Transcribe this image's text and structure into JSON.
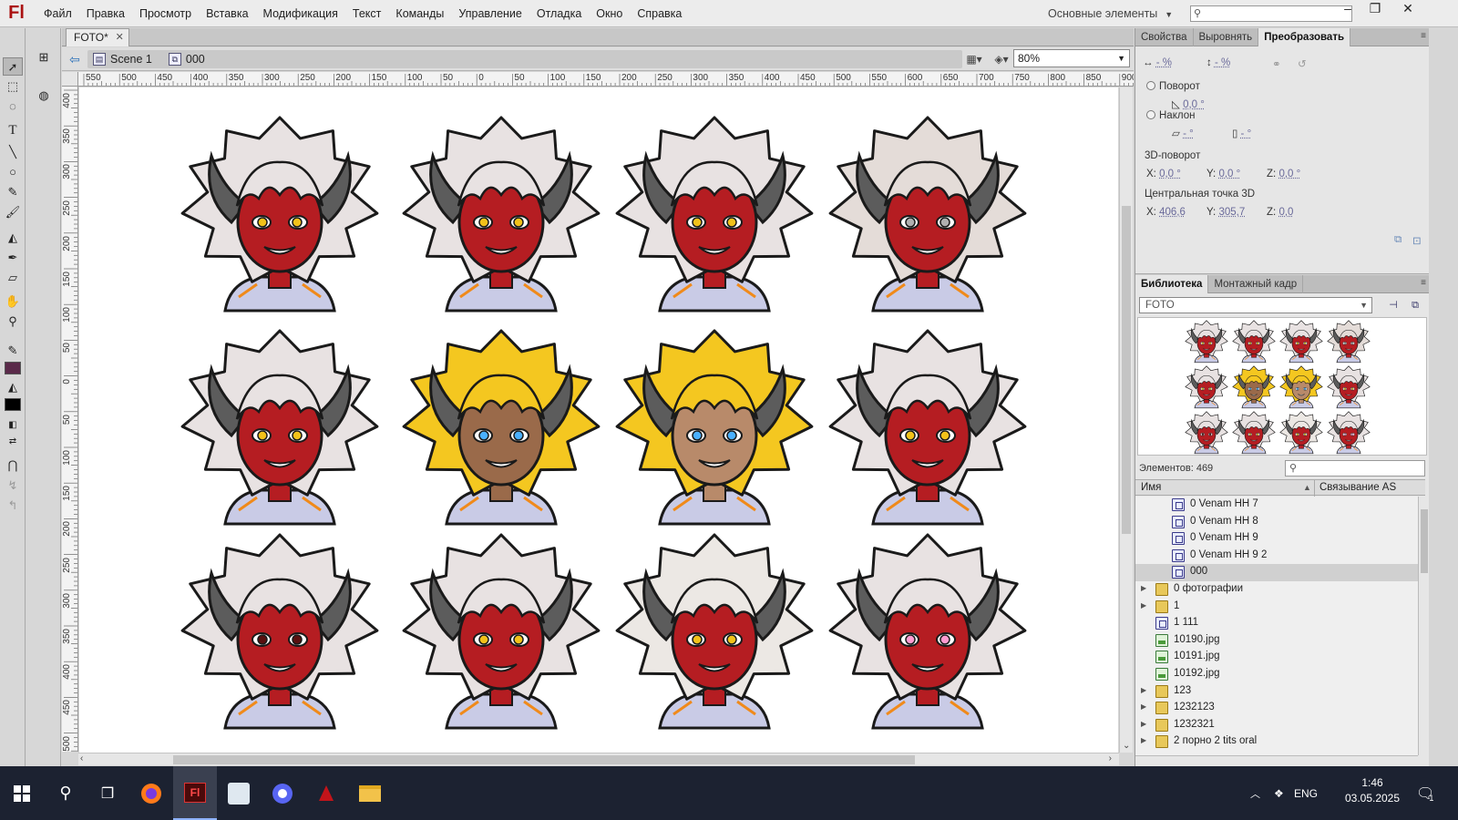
{
  "app": {
    "logo": "Fl",
    "menu": [
      "Файл",
      "Правка",
      "Просмотр",
      "Вставка",
      "Модификация",
      "Текст",
      "Команды",
      "Управление",
      "Отладка",
      "Окно",
      "Справка"
    ],
    "workspace": "Основные элементы",
    "window_controls": [
      "–",
      "❐",
      "✕"
    ]
  },
  "document": {
    "tab_title": "FOTO*",
    "breadcrumb": [
      {
        "label": "Scene 1",
        "icon": "scene-icon"
      },
      {
        "label": "000",
        "icon": "symbol-icon"
      }
    ],
    "zoom": "80%"
  },
  "rulers": {
    "top_labels": [
      "550",
      "500",
      "450",
      "400",
      "350",
      "300",
      "250",
      "200",
      "150",
      "100",
      "50",
      "0",
      "50",
      "100",
      "150",
      "200",
      "250",
      "300",
      "350",
      "400",
      "450",
      "500",
      "550",
      "600",
      "650",
      "700",
      "750",
      "800",
      "850",
      "900"
    ],
    "left_labels": [
      "400",
      "350",
      "300",
      "250",
      "200",
      "150",
      "100",
      "50",
      "0",
      "50",
      "100",
      "150",
      "200",
      "250",
      "300",
      "350",
      "400",
      "450",
      "500"
    ]
  },
  "stage": {
    "characters": [
      {
        "hair": "#e8e2e2",
        "skin": "#b51d22",
        "eyes": "#f2c21a"
      },
      {
        "hair": "#e8e2e2",
        "skin": "#b51d22",
        "eyes": "#f2c21a"
      },
      {
        "hair": "#e8e2e2",
        "skin": "#b51d22",
        "eyes": "#f2c21a"
      },
      {
        "hair": "#e4dcd8",
        "skin": "#b51d22",
        "eyes": "#b0b0b0"
      },
      {
        "hair": "#e8e2e2",
        "skin": "#b51d22",
        "eyes": "#f2c21a"
      },
      {
        "hair": "#f4c720",
        "skin": "#9a6a4a",
        "eyes": "#4ab0ff"
      },
      {
        "hair": "#f4c720",
        "skin": "#b88a6a",
        "eyes": "#4ab0ff"
      },
      {
        "hair": "#e8e2e2",
        "skin": "#b51d22",
        "eyes": "#f2c21a"
      },
      {
        "hair": "#e8e2e2",
        "skin": "#b51d22",
        "eyes": "#5a1010"
      },
      {
        "hair": "#e8e2e2",
        "skin": "#b51d22",
        "eyes": "#f2c21a"
      },
      {
        "hair": "#ece8e4",
        "skin": "#b51d22",
        "eyes": "#f2c21a"
      },
      {
        "hair": "#e8e2e2",
        "skin": "#b51d22",
        "eyes": "#ff9ad0"
      }
    ]
  },
  "properties": {
    "tabs": [
      "Свойства",
      "Выровнять",
      "Преобразовать"
    ],
    "active_tab": "Преобразовать",
    "width_pct": "- %",
    "height_pct": "- %",
    "rotate_label": "Поворот",
    "rotate_value": "0,0 °",
    "skew_label": "Наклон",
    "skew_h": "- °",
    "skew_v": "- °",
    "rotation3d_label": "3D-поворот",
    "rot3d": {
      "x_label": "X:",
      "x": "0,0 °",
      "y_label": "Y:",
      "y": "0,0 °",
      "z_label": "Z:",
      "z": "0,0 °"
    },
    "center3d_label": "Центральная точка 3D",
    "center3d": {
      "x_label": "X:",
      "x": "406,6",
      "y_label": "Y:",
      "y": "305,7",
      "z_label": "Z:",
      "z": "0,0"
    }
  },
  "library": {
    "tabs": [
      "Библиотека",
      "Монтажный кадр"
    ],
    "active_tab": "Библиотека",
    "document": "FOTO",
    "count_label": "Элементов: 469",
    "columns": [
      "Имя",
      "Связывание AS"
    ],
    "items": [
      {
        "name": "0 Venam HH 7",
        "type": "symbol",
        "indent": 2,
        "selected": false
      },
      {
        "name": "0 Venam HH 8",
        "type": "symbol",
        "indent": 2,
        "selected": false
      },
      {
        "name": "0 Venam HH 9",
        "type": "symbol",
        "indent": 2,
        "selected": false
      },
      {
        "name": "0 Venam HH 9 2",
        "type": "symbol",
        "indent": 2,
        "selected": false
      },
      {
        "name": "000",
        "type": "symbol",
        "indent": 2,
        "selected": true
      },
      {
        "name": "0 фотографии",
        "type": "folder",
        "indent": 1,
        "selected": false
      },
      {
        "name": "1",
        "type": "folder",
        "indent": 1,
        "selected": false
      },
      {
        "name": "1 111",
        "type": "symbol",
        "indent": 1,
        "selected": false
      },
      {
        "name": "10190.jpg",
        "type": "bitmap",
        "indent": 1,
        "selected": false
      },
      {
        "name": "10191.jpg",
        "type": "bitmap",
        "indent": 1,
        "selected": false
      },
      {
        "name": "10192.jpg",
        "type": "bitmap",
        "indent": 1,
        "selected": false
      },
      {
        "name": "123",
        "type": "folder",
        "indent": 1,
        "selected": false
      },
      {
        "name": "1232123",
        "type": "folder",
        "indent": 1,
        "selected": false
      },
      {
        "name": "1232321",
        "type": "folder",
        "indent": 1,
        "selected": false
      },
      {
        "name": "2 порно 2 tits oral",
        "type": "folder",
        "indent": 1,
        "selected": false
      }
    ]
  },
  "taskbar": {
    "apps": [
      {
        "name": "search-icon",
        "glyph": "⚲"
      },
      {
        "name": "task-view-icon",
        "glyph": "❒"
      },
      {
        "name": "firefox-icon",
        "glyph": ""
      },
      {
        "name": "flash-icon",
        "glyph": "Fl"
      },
      {
        "name": "wolf-app-icon",
        "glyph": ""
      },
      {
        "name": "discord-icon",
        "glyph": ""
      },
      {
        "name": "game-icon",
        "glyph": ""
      },
      {
        "name": "explorer-icon",
        "glyph": ""
      }
    ],
    "language": "ENG",
    "time": "1:46",
    "date": "03.05.2025",
    "notifications": "1"
  }
}
